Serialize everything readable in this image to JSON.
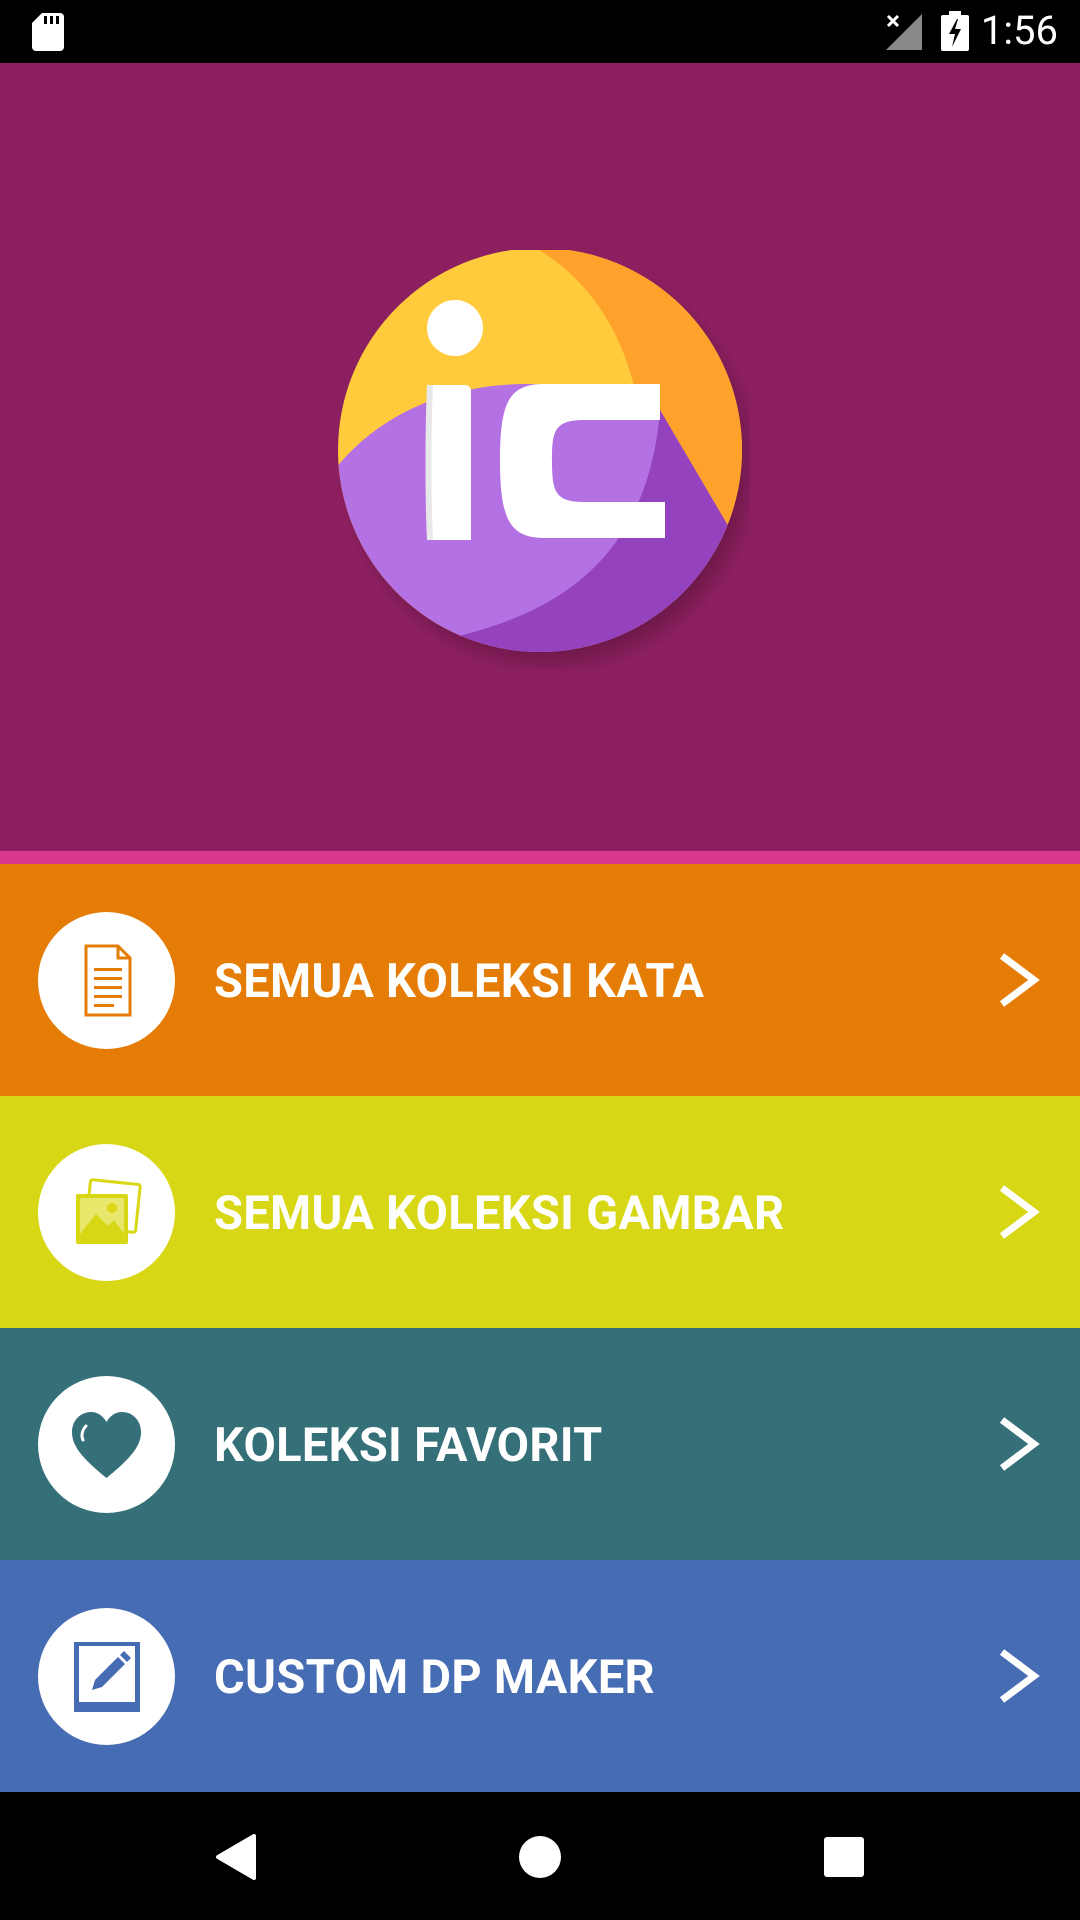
{
  "status_bar": {
    "time": "1:56",
    "icons": [
      "sd-card-icon",
      "no-signal-icon",
      "battery-charging-icon"
    ]
  },
  "header": {
    "logo_icon": "ic-logo-icon",
    "logo_text": "iC",
    "background": "#8C1F5F",
    "stripe_color": "#D9378E"
  },
  "menu": {
    "items": [
      {
        "label": "SEMUA KOLEKSI KATA",
        "icon": "document-icon",
        "color": "#E57C06"
      },
      {
        "label": "SEMUA KOLEKSI GAMBAR",
        "icon": "images-icon",
        "color": "#D8D716"
      },
      {
        "label": "KOLEKSI FAVORIT",
        "icon": "heart-icon",
        "color": "#357079"
      },
      {
        "label": "CUSTOM DP MAKER",
        "icon": "edit-icon",
        "color": "#466CB3"
      }
    ]
  },
  "nav_bar": {
    "icons": [
      "back-icon",
      "home-icon",
      "recents-icon"
    ]
  }
}
